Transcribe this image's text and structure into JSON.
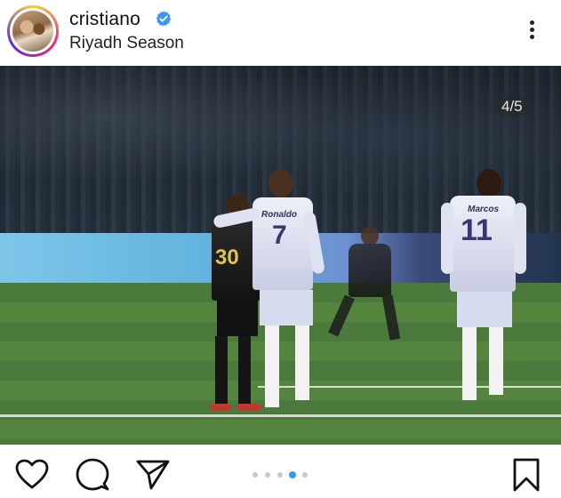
{
  "post": {
    "username": "cristiano",
    "location": "Riyadh Season",
    "verified": true,
    "image_counter": "4/5",
    "carousel_total": 5,
    "carousel_active_index": 3
  },
  "photo": {
    "jersey_names": [
      "Ronaldo",
      "Marcos"
    ],
    "jersey_numbers": [
      "30",
      "7",
      "11"
    ]
  },
  "icons": {
    "verified": "verified-badge-icon",
    "more": "more-options-icon",
    "like": "heart-icon",
    "comment": "comment-icon",
    "share": "send-icon",
    "save": "bookmark-icon"
  },
  "colors": {
    "verified_blue": "#3897f0",
    "active_dot": "#3897f0",
    "inactive_dot": "#c8c8c8"
  }
}
